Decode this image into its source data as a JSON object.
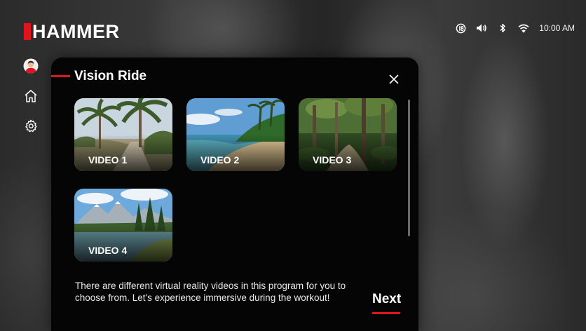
{
  "brand": {
    "name": "HAMMER",
    "accent": "#e0141e"
  },
  "status_bar": {
    "icons": [
      "notification-badge-icon",
      "volume-icon",
      "bluetooth-icon",
      "wifi-icon"
    ],
    "time": "10:00 AM"
  },
  "sidebar": {
    "items": [
      {
        "icon": "avatar-icon",
        "label": "Profile"
      },
      {
        "icon": "home-icon",
        "label": "Home"
      },
      {
        "icon": "gear-icon",
        "label": "Settings"
      }
    ]
  },
  "dialog": {
    "title": "Vision Ride",
    "videos": [
      {
        "label": "VIDEO 1",
        "scene": "palm trees path"
      },
      {
        "label": "VIDEO 2",
        "scene": "tropical beach"
      },
      {
        "label": "VIDEO 3",
        "scene": "forest trail"
      },
      {
        "label": "VIDEO 4",
        "scene": "mountain lake"
      }
    ],
    "description": "There are different virtual reality videos in this program for you to choose from. Let's experience immersive during the workout!",
    "next_label": "Next"
  }
}
